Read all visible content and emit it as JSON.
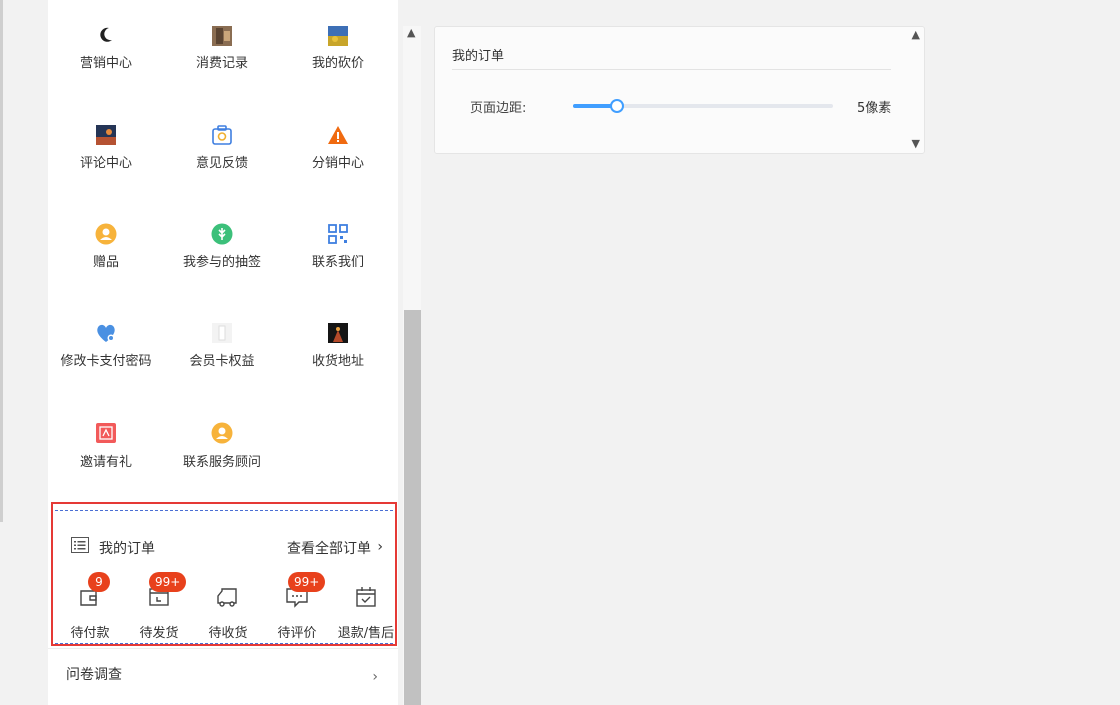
{
  "grid": [
    {
      "label": "营销中心",
      "icon": "marketing-icon"
    },
    {
      "label": "消费记录",
      "icon": "consumption-record-image"
    },
    {
      "label": "我的砍价",
      "icon": "bargain-image"
    },
    {
      "label": "评论中心",
      "icon": "comment-image"
    },
    {
      "label": "意见反馈",
      "icon": "camera-icon"
    },
    {
      "label": "分销中心",
      "icon": "warning-icon"
    },
    {
      "label": "赠品",
      "icon": "gift-user-icon"
    },
    {
      "label": "我参与的抽签",
      "icon": "lottery-icon"
    },
    {
      "label": "联系我们",
      "icon": "grid-qr-icon"
    },
    {
      "label": "修改卡支付密码",
      "icon": "heart-lock-icon"
    },
    {
      "label": "会员卡权益",
      "icon": "member-card-image"
    },
    {
      "label": "收货地址",
      "icon": "address-image"
    },
    {
      "label": "邀请有礼",
      "icon": "invite-icon"
    },
    {
      "label": "联系服务顾问",
      "icon": "advisor-user-icon"
    }
  ],
  "orders": {
    "title": "我的订单",
    "view_all": "查看全部订单",
    "chevron": "›",
    "items": [
      {
        "label": "待付款",
        "badge": "9",
        "icon": "wallet-icon"
      },
      {
        "label": "待发货",
        "badge": "99+",
        "icon": "box-icon"
      },
      {
        "label": "待收货",
        "badge": "",
        "icon": "truck-icon"
      },
      {
        "label": "待评价",
        "badge": "99+",
        "icon": "review-icon"
      },
      {
        "label": "退款/售后",
        "badge": "",
        "icon": "calendar-check-icon"
      }
    ]
  },
  "survey": {
    "label": "问卷调查",
    "chevron": "›"
  },
  "panel": {
    "title": "我的订单",
    "margin_label": "页面边距:",
    "margin_value": "5像素",
    "margin_fraction": 0.17
  },
  "colors": {
    "accent": "#409eff",
    "badge": "#e8411c",
    "highlight": "#e53935"
  }
}
